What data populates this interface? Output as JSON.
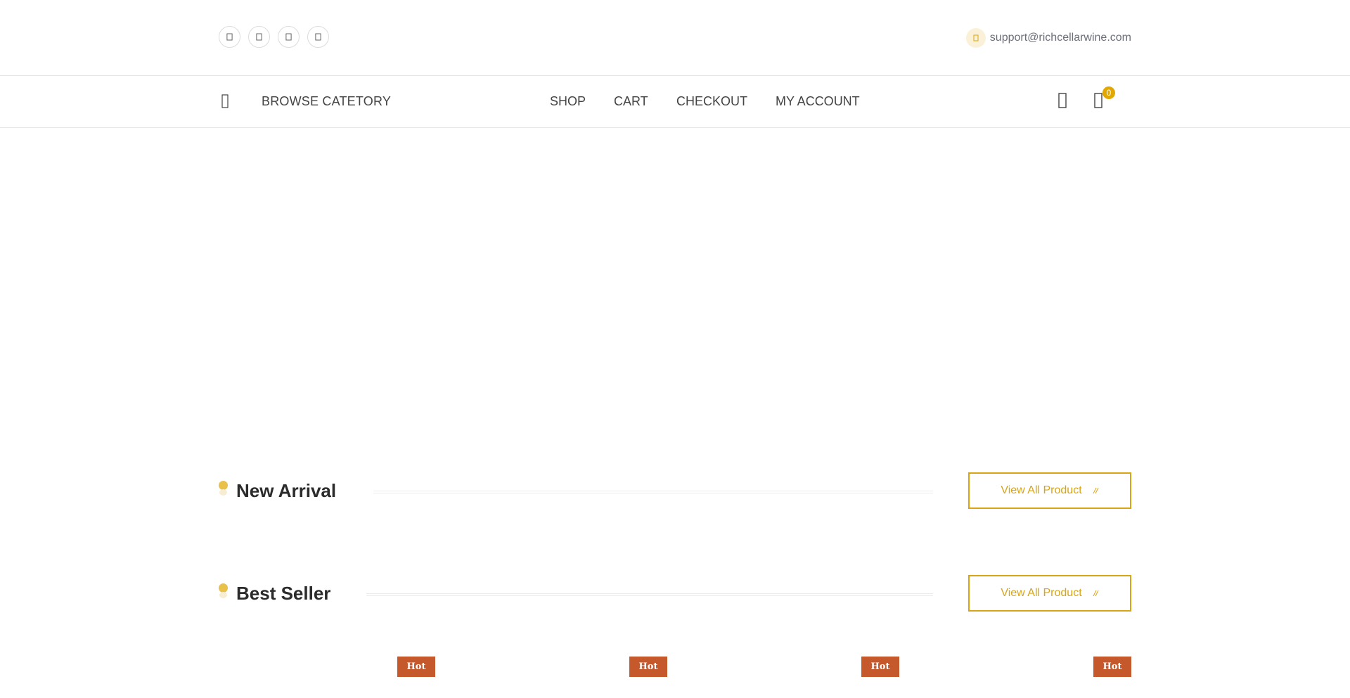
{
  "topbar": {
    "social_icons": [
      "facebook-icon",
      "twitter-icon",
      "instagram-icon",
      "pinterest-icon"
    ],
    "email": "support@richcellarwine.com"
  },
  "nav": {
    "browse_label": "BROWSE CATETORY",
    "links": [
      "SHOP",
      "CART",
      "CHECKOUT",
      "MY ACCOUNT"
    ],
    "cart_count": "0"
  },
  "sections": [
    {
      "title": "New Arrival",
      "button": "View All Product"
    },
    {
      "title": "Best Seller",
      "button": "View All Product"
    }
  ],
  "badges": [
    "Hot",
    "Hot",
    "Hot",
    "Hot"
  ],
  "colors": {
    "accent": "#d9a514",
    "badge": "#c5592c",
    "dot": "#e8c04a"
  }
}
